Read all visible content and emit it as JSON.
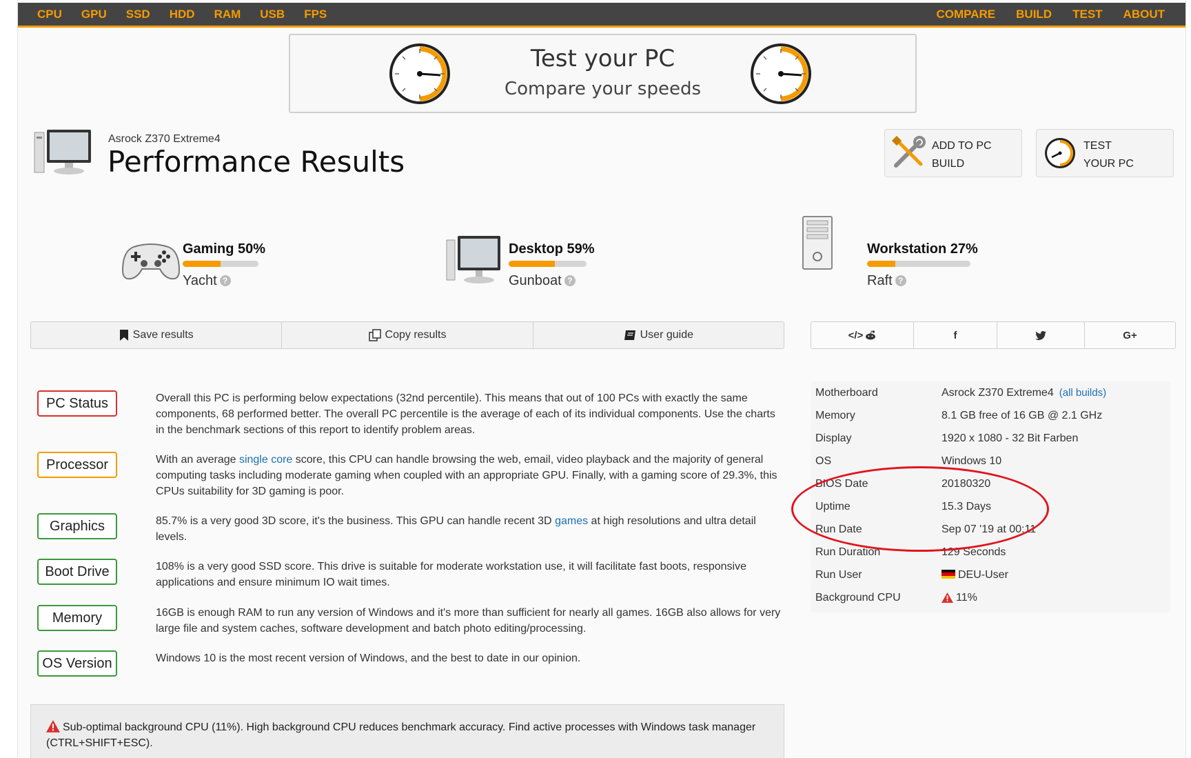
{
  "nav": {
    "left": [
      "CPU",
      "GPU",
      "SSD",
      "HDD",
      "RAM",
      "USB",
      "FPS"
    ],
    "right": [
      "COMPARE",
      "BUILD",
      "TEST",
      "ABOUT"
    ]
  },
  "banner": {
    "title": "Test your PC",
    "subtitle": "Compare your speeds",
    "icon": "speed-gauge-icon"
  },
  "header": {
    "subtitle": "Asrock Z370 Extreme4",
    "title": "Performance Results",
    "add_build_line1": "ADD TO PC",
    "add_build_line2": "BUILD",
    "test_pc_line1": "TEST",
    "test_pc_line2": "YOUR PC"
  },
  "usage": [
    {
      "name": "Gaming 50%",
      "label": "Yacht",
      "percent": 50,
      "icon": "gamepad-icon"
    },
    {
      "name": "Desktop 59%",
      "label": "Gunboat",
      "percent": 59,
      "icon": "desktop-icon"
    },
    {
      "name": "Workstation 27%",
      "label": "Raft",
      "percent": 27,
      "icon": "workstation-icon"
    }
  ],
  "actions": {
    "save": "Save results",
    "copy": "Copy results",
    "guide": "User guide"
  },
  "share": {
    "embed_symbol": "</>",
    "facebook": "f",
    "gplus": "G+"
  },
  "status": [
    {
      "badge": "PC Status",
      "color": "#d9302c",
      "text": "Overall this PC is performing below expectations (32nd percentile). This means that out of 100 PCs with exactly the same components, 68 performed better. The overall PC percentile is the average of each of its individual components. Use the charts in the benchmark sections of this report to identify problem areas."
    },
    {
      "badge": "Processor",
      "color": "#f59b00",
      "text_before": "With an average ",
      "link": "single core",
      "text_after": " score, this CPU can handle browsing the web, email, video playback and the majority of general computing tasks including moderate gaming when coupled with an appropriate GPU. Finally, with a gaming score of 29.3%, this CPUs suitability for 3D gaming is poor."
    },
    {
      "badge": "Graphics",
      "color": "#3a9a3a",
      "text_before": "85.7% is a very good 3D score, it's the business. This GPU can handle recent 3D ",
      "link": "games",
      "text_after": " at high resolutions and ultra detail levels."
    },
    {
      "badge": "Boot Drive",
      "color": "#3a9a3a",
      "text": "108% is a very good SSD score. This drive is suitable for moderate workstation use, it will facilitate fast boots, responsive applications and ensure minimum IO wait times."
    },
    {
      "badge": "Memory",
      "color": "#3a9a3a",
      "text": "16GB is enough RAM to run any version of Windows and it's more than sufficient for nearly all games. 16GB also allows for very large file and system caches, software development and batch photo editing/processing."
    },
    {
      "badge": "OS Version",
      "color": "#3a9a3a",
      "text": "Windows 10 is the most recent version of Windows, and the best to date in our opinion."
    }
  ],
  "info": {
    "motherboard_key": "Motherboard",
    "motherboard_val": "Asrock Z370 Extreme4",
    "all_builds": "(all builds)",
    "memory_key": "Memory",
    "memory_val": "8.1 GB free of 16 GB @ 2.1 GHz",
    "display_key": "Display",
    "display_val": "1920 x 1080 - 32 Bit Farben",
    "os_key": "OS",
    "os_val": "Windows 10",
    "bios_key": "BIOS Date",
    "bios_val": "20180320",
    "uptime_key": "Uptime",
    "uptime_val": "15.3 Days",
    "rundate_key": "Run Date",
    "rundate_val": "Sep 07 '19 at 00:11",
    "runduration_key": "Run Duration",
    "runduration_val": "129 Seconds",
    "runuser_key": "Run User",
    "runuser_val": "DEU-User",
    "bgcpu_key": "Background CPU",
    "bgcpu_val": "11%"
  },
  "warning": {
    "text": "Sub-optimal background CPU (11%). High background CPU reduces benchmark accuracy. Find active processes with Windows task manager (CTRL+SHIFT+ESC)."
  },
  "colors": {
    "accent": "#f59b00",
    "nav_bg": "#444444",
    "link": "#1a6fb5",
    "annotation_circle": "#e0151d"
  }
}
